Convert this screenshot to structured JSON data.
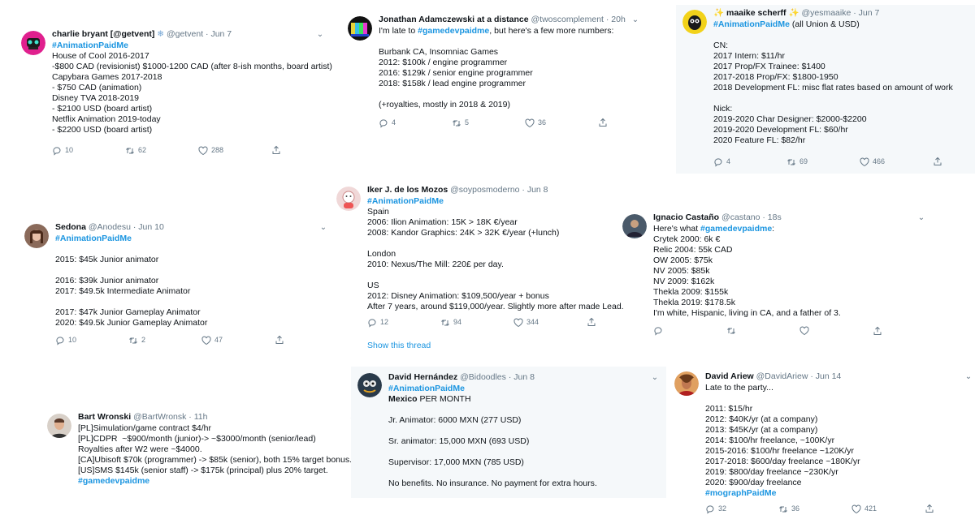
{
  "tweets": {
    "charlie": {
      "name": "charlie bryant [@getvent]",
      "handle": "@getvent · Jun 7",
      "lines": [
        "#AnimationPaidMe",
        "House of Cool 2016-2017",
        "-$800 CAD (revisionist) $1000-1200 CAD (after 8-ish months, board artist)",
        "Capybara Games 2017-2018",
        "- $750 CAD (animation)",
        "Disney TVA 2018-2019",
        "- $2100 USD (board artist)",
        "Netflix Animation 2019-today",
        "- $2200 USD (board artist)"
      ],
      "replies": "10",
      "retweets": "62",
      "likes": "288"
    },
    "jonathan": {
      "name": "Jonathan Adamczewski at a distance",
      "handle": "@twoscomplement · 20h",
      "line1_pre": "I'm late to ",
      "line1_tag": "#gamedevpaidme",
      "line1_post": ", but here's a few more numbers:",
      "lines": [
        "",
        "Burbank CA, Insomniac Games",
        "2012: $100k / engine programmer",
        "2016: $129k / senior engine programmer",
        "2018: $158k / lead engine programmer",
        "",
        "(+royalties, mostly in 2018 & 2019)"
      ],
      "replies": "4",
      "retweets": "5",
      "likes": "36"
    },
    "maaike": {
      "name": "maaike scherff",
      "sparkle": "✨",
      "handle": "@yesmaaike · Jun 7",
      "tag": "#AnimationPaidMe",
      "tag_post": " (all Union & USD)",
      "lines": [
        "",
        "CN:",
        "2017 Intern: $11/hr",
        "2017 Prop/FX Trainee: $1400",
        "2017-2018 Prop/FX: $1800-1950",
        "2018 Development FL: misc flat rates based on amount of work",
        "",
        "Nick:",
        "2019-2020 Char Designer: $2000-$2200",
        "2019-2020 Development FL: $60/hr",
        "2020 Feature FL: $82/hr"
      ],
      "replies": "4",
      "retweets": "69",
      "likes": "466"
    },
    "iker": {
      "name": "Iker J. de los Mozos",
      "handle": "@soyposmoderno · Jun 8",
      "lines": [
        "#AnimationPaidMe",
        "Spain",
        "2006: Ilion Animation: 15K > 18K €/year",
        "2008: Kandor Graphics: 24K > 32K €/year (+lunch)",
        "",
        "London",
        "2010: Nexus/The Mill: 220£ per day.",
        "",
        "US",
        "2012: Disney Animation: $109,500/year + bonus",
        "After 7 years, around $119,000/year. Slightly more after made Lead."
      ],
      "replies": "12",
      "retweets": "94",
      "likes": "344",
      "show_thread": "Show this thread"
    },
    "sedona": {
      "name": "Sedona",
      "handle": "@Anodesu · Jun 10",
      "lines": [
        "#AnimationPaidMe",
        "",
        "2015: $45k Junior animator",
        "",
        "2016: $39k Junior animator",
        "2017: $49.5k Intermediate Animator",
        "",
        "2017: $47k Junior Gameplay Animator",
        "2020: $49.5k Junior Gameplay Animator"
      ],
      "replies": "10",
      "retweets": "2",
      "likes": "47"
    },
    "ignacio": {
      "name": "Ignacio Castaño",
      "handle": "@castano · 18s",
      "line1_pre": "Here's what ",
      "line1_tag": "#gamedevpaidme",
      "line1_post": ":",
      "lines": [
        "Crytek 2000: 6k €",
        "Relic 2004: 55k CAD",
        "OW 2005: $75k",
        "NV 2005: $85k",
        "NV 2009: $162k",
        "Thekla 2009: $155k",
        "Thekla 2019: $178.5k",
        "I'm white, Hispanic, living in CA, and a father of 3."
      ]
    },
    "bart": {
      "name": "Bart Wronski",
      "handle": "@BartWronsk · 11h",
      "lines": [
        "[PL]Simulation/game contract $4/hr",
        "[PL]CDPR  ~$900/month (junior)-> ~$3000/month (senior/lead)",
        "Royalties after W2 were ~$4000.",
        "[CA]Ubisoft $70k (programmer) -> $85k (senior), both 15% target bonus.",
        "[US]SMS $145k (senior staff) -> $175k (principal) plus 20% target.",
        "#gamedevpaidme"
      ]
    },
    "david_h": {
      "name": "David Hernández",
      "handle": "@Bidoodles · Jun 8",
      "tag": "#AnimationPaidMe",
      "line2_bold": "Mexico",
      "line2_post": " PER MONTH",
      "lines": [
        "",
        "Jr. Animator: 6000 MXN (277 USD)",
        "",
        "Sr. animator: 15,000 MXN (693 USD)",
        "",
        "Supervisor: 17,000 MXN (785 USD)",
        "",
        "No benefits. No insurance. No payment for extra hours."
      ]
    },
    "david_a": {
      "name": "David Ariew",
      "handle": "@DavidAriew · Jun 14",
      "lines": [
        "Late to the party...",
        "",
        "2011: $15/hr",
        "2012: $40K/yr (at a company)",
        "2013: $45K/yr (at a company)",
        "2014: $100/hr freelance, ~100K/yr",
        "2015-2016: $100/hr freelance ~120K/yr",
        "2017-2018: $600/day freelance ~180K/yr",
        "2019: $800/day freelance ~230K/yr",
        "2020: $900/day freelance",
        "#mographPaidMe"
      ],
      "replies": "32",
      "retweets": "36",
      "likes": "421"
    }
  },
  "icons": {
    "reply": "reply-icon",
    "retweet": "retweet-icon",
    "like": "heart-icon",
    "share": "share-icon",
    "more": "chevron-down-icon"
  },
  "colors": {
    "link": "#1b95e0",
    "muted": "#657786",
    "panel": "#f5f8fa",
    "text": "#0f1419"
  }
}
